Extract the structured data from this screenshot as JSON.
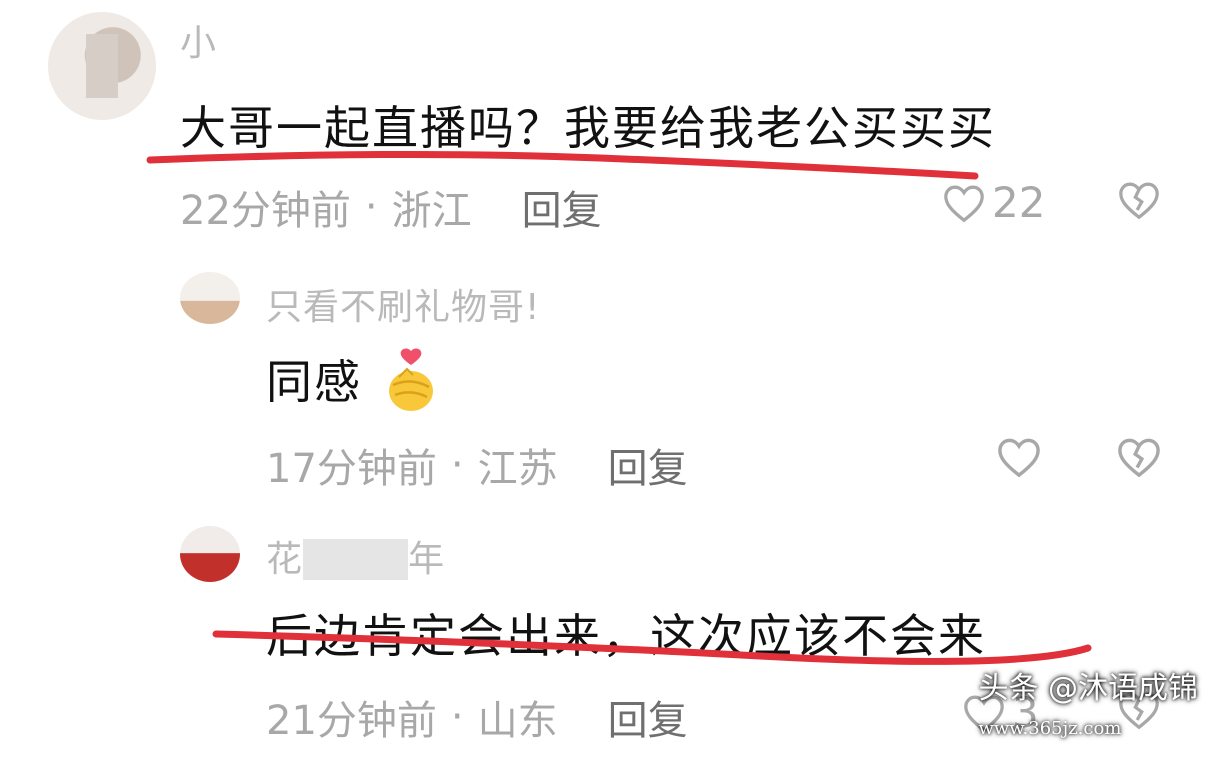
{
  "comments": [
    {
      "username": "小",
      "text": "大哥一起直播吗？我要给我老公买买买",
      "time": "22分钟前",
      "location": "浙江",
      "reply": "回复",
      "likes": "22"
    },
    {
      "username": "只看不刷礼物哥!",
      "text": "同感",
      "time": "17分钟前",
      "location": "江苏",
      "reply": "回复",
      "likes": ""
    },
    {
      "username": "花",
      "username_tail": "年",
      "text": "后边肯定会出来，这次应该不会来",
      "time": "21分钟前",
      "location": "山东",
      "reply": "回复",
      "likes": "3"
    }
  ],
  "meta_separator": "·",
  "watermark": {
    "text": "头条 @沐语成锦",
    "site": "www.365jz.com"
  },
  "colors": {
    "underline": "#e0303a",
    "meta": "#a8a8a8",
    "text": "#111111"
  },
  "icons": [
    "heart-outline-icon",
    "broken-heart-icon",
    "finger-heart-emoji"
  ]
}
